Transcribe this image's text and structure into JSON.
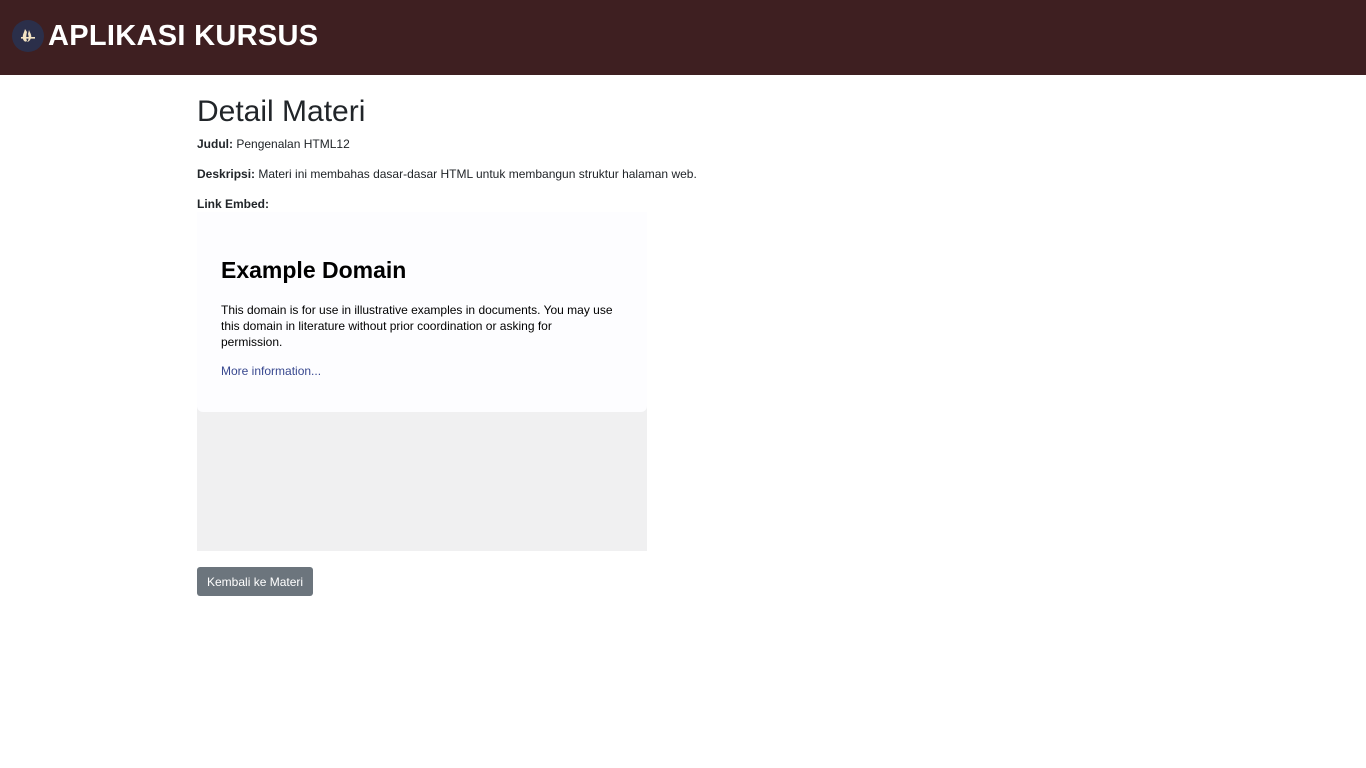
{
  "navbar": {
    "brand": "APLIKASI KURSUS",
    "logo_icon": "flame-logo-icon"
  },
  "main": {
    "title": "Detail Materi",
    "judul_label": "Judul:",
    "judul_value": "Pengenalan HTML12",
    "deskripsi_label": "Deskripsi:",
    "deskripsi_value": "Materi ini membahas dasar-dasar HTML untuk membangun struktur halaman web.",
    "link_embed_label": "Link Embed:",
    "back_button_label": "Kembali ke Materi"
  },
  "embed": {
    "title": "Example Domain",
    "text": "This domain is for use in illustrative examples in documents. You may use this domain in literature without prior coordination or asking for permission.",
    "link_text": "More information..."
  },
  "colors": {
    "navbar_bg": "#3e1f21",
    "button_bg": "#6c757d",
    "link": "#38488f"
  }
}
